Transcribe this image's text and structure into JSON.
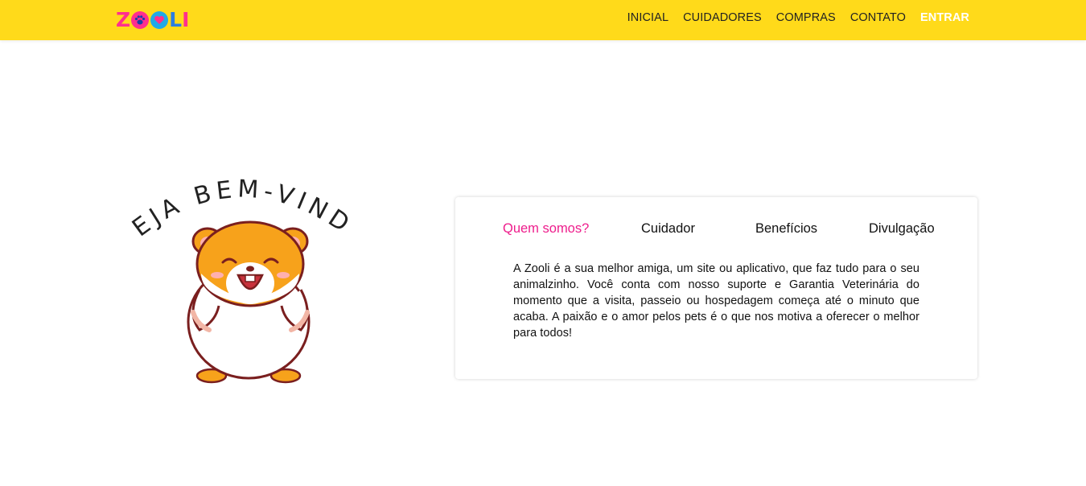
{
  "header": {
    "logo_text": "ZOOLI",
    "nav": [
      {
        "label": "INICIAL"
      },
      {
        "label": "CUIDADORES"
      },
      {
        "label": "COMPRAS"
      },
      {
        "label": "CONTATO"
      },
      {
        "label": "ENTRAR"
      }
    ]
  },
  "hero": {
    "welcome_text": "SEJA BEM-VINDO",
    "mascot": "hamster-mascot"
  },
  "info_card": {
    "tabs": [
      {
        "label": "Quem somos?",
        "active": true
      },
      {
        "label": "Cuidador",
        "active": false
      },
      {
        "label": "Benefícios",
        "active": false
      },
      {
        "label": "Divulgação",
        "active": false
      }
    ],
    "content": "A Zooli é a sua melhor amiga, um site ou aplicativo, que faz tudo para o seu animalzinho. Você conta com nosso suporte e Garantia Veterinária do momento que a visita, passeio ou hospedagem começa até o minuto que acaba. A paixão e o amor pelos pets é o que nos motiva a oferecer o melhor para todos!"
  },
  "colors": {
    "navbar": "#ffda1a",
    "accent_pink": "#ee1d8c",
    "accent_blue": "#21a9e6"
  }
}
